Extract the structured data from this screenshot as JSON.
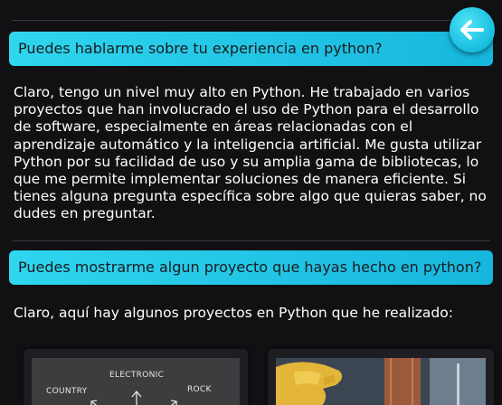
{
  "conversation": [
    {
      "question": "Puedes hablarme sobre tu experiencia en python?",
      "answer": "Claro, tengo un nivel muy alto en Python. He trabajado en varios proyectos que han involucrado el uso de Python para el desarrollo de software, especialmente en áreas relacionadas con el aprendizaje automático y la inteligencia artificial. Me gusta utilizar Python por su facilidad de uso y su amplia gama de bibliotecas, lo que me permite implementar soluciones de manera eficiente. Si tienes alguna pregunta específica sobre algo que quieras saber, no dudes en preguntar."
    },
    {
      "question": "Puedes mostrarme algun proyecto que hayas hecho en python?",
      "answer": "Claro, aquí hay algunos proyectos en Python que he realizado:"
    }
  ],
  "projects": [
    {
      "image_labels": [
        "ELECTRONIC",
        "COUNTRY",
        "ROCK"
      ]
    },
    {
      "image_icon": "photo-thumbnail"
    }
  ],
  "back_button": {
    "icon": "arrow-left-icon",
    "color": "#1ec3e3"
  },
  "colors": {
    "background": "#111114",
    "question_bubble": "#1ec3e3",
    "question_text": "#1b1b1f",
    "answer_text": "#ffffff"
  }
}
